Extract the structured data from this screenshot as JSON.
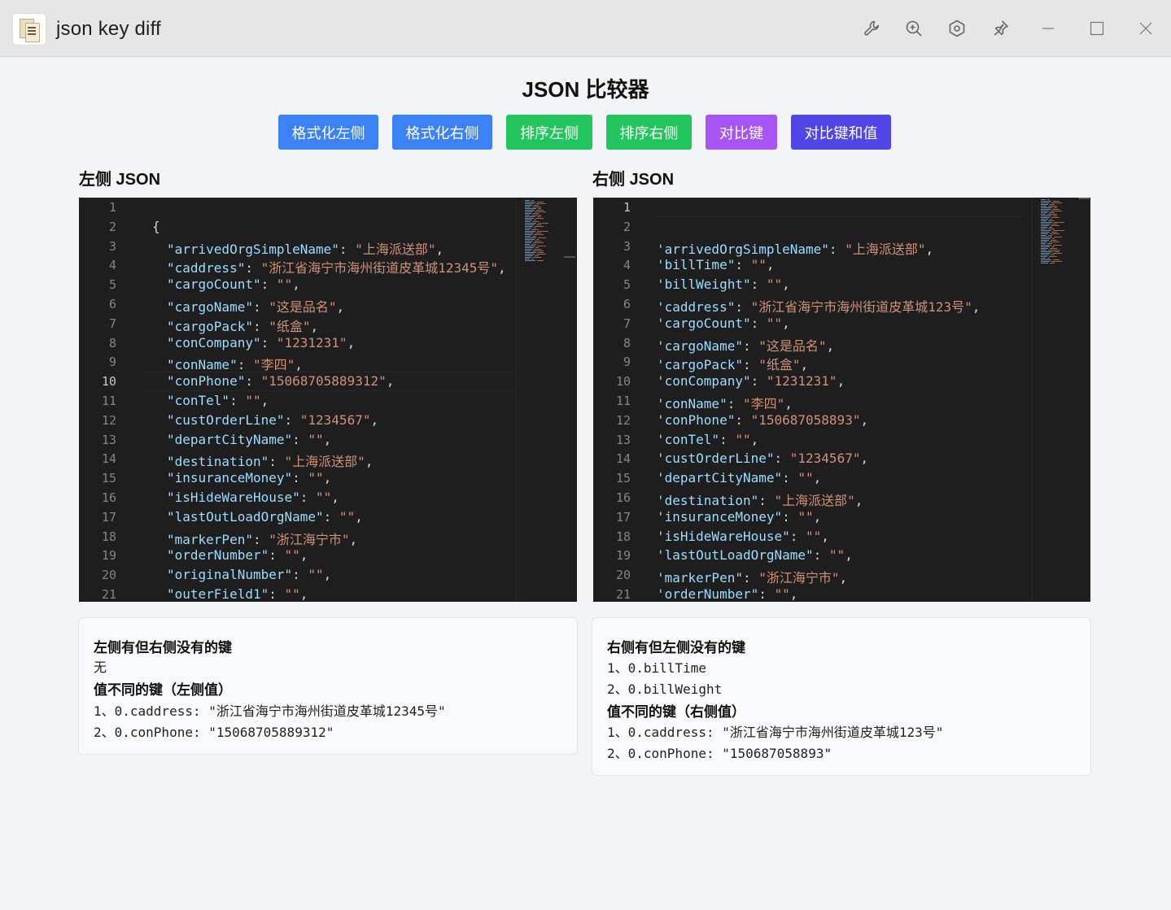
{
  "window": {
    "title": "json key diff",
    "toolbar_icons": [
      "wrench-icon",
      "zoom-in-icon",
      "settings-hex-icon",
      "pin-icon"
    ],
    "controls": [
      "minimize",
      "maximize",
      "close"
    ]
  },
  "page": {
    "title": "JSON 比较器"
  },
  "buttons": [
    {
      "label": "格式化左侧",
      "color": "#3b82f6"
    },
    {
      "label": "格式化右侧",
      "color": "#3b82f6"
    },
    {
      "label": "排序左侧",
      "color": "#22c55e"
    },
    {
      "label": "排序右侧",
      "color": "#22c55e"
    },
    {
      "label": "对比键",
      "color": "#a855f7"
    },
    {
      "label": "对比键和值",
      "color": "#4f46e5"
    }
  ],
  "left": {
    "label": "左侧 JSON",
    "lines": [
      [
        "1",
        ""
      ],
      [
        "2",
        "{"
      ],
      [
        "3",
        "arrivedOrgSimpleName",
        "上海派送部"
      ],
      [
        "4",
        "caddress",
        "浙江省海宁市海州街道皮革城12345号"
      ],
      [
        "5",
        "cargoCount",
        ""
      ],
      [
        "6",
        "cargoName",
        "这是品名"
      ],
      [
        "7",
        "cargoPack",
        "纸盒"
      ],
      [
        "8",
        "conCompany",
        "1231231"
      ],
      [
        "9",
        "conName",
        "李四"
      ],
      [
        "10",
        "conPhone",
        "15068705889312"
      ],
      [
        "11",
        "conTel",
        ""
      ],
      [
        "12",
        "custOrderLine",
        "1234567"
      ],
      [
        "13",
        "departCityName",
        ""
      ],
      [
        "14",
        "destination",
        "上海派送部"
      ],
      [
        "15",
        "insuranceMoney",
        ""
      ],
      [
        "16",
        "isHideWareHouse",
        ""
      ],
      [
        "17",
        "lastOutLoadOrgName",
        ""
      ],
      [
        "18",
        "markerPen",
        "浙江海宁市"
      ],
      [
        "19",
        "orderNumber",
        ""
      ],
      [
        "20",
        "originalNumber",
        ""
      ],
      [
        "21",
        "outerField1",
        ""
      ]
    ],
    "result": {
      "missing_title": "左侧有但右侧没有的键",
      "missing_items": [
        "无"
      ],
      "diff_title": "值不同的键（左侧值）",
      "diff_items": [
        "1、0.caddress: \"浙江省海宁市海州街道皮革城12345号\"",
        "2、0.conPhone: \"15068705889312\""
      ]
    }
  },
  "right": {
    "label": "右侧 JSON",
    "lines": [
      [
        "1",
        ""
      ],
      [
        "2",
        ""
      ],
      [
        "3",
        "arrivedOrgSimpleName",
        "上海派送部"
      ],
      [
        "4",
        "billTime",
        ""
      ],
      [
        "5",
        "billWeight",
        ""
      ],
      [
        "6",
        "caddress",
        "浙江省海宁市海州街道皮革城123号"
      ],
      [
        "7",
        "cargoCount",
        ""
      ],
      [
        "8",
        "cargoName",
        "这是品名"
      ],
      [
        "9",
        "cargoPack",
        "纸盒"
      ],
      [
        "10",
        "conCompany",
        "1231231"
      ],
      [
        "11",
        "conName",
        "李四"
      ],
      [
        "12",
        "conPhone",
        "150687058893"
      ],
      [
        "13",
        "conTel",
        ""
      ],
      [
        "14",
        "custOrderLine",
        "1234567"
      ],
      [
        "15",
        "departCityName",
        ""
      ],
      [
        "16",
        "destination",
        "上海派送部"
      ],
      [
        "17",
        "insuranceMoney",
        ""
      ],
      [
        "18",
        "isHideWareHouse",
        ""
      ],
      [
        "19",
        "lastOutLoadOrgName",
        ""
      ],
      [
        "20",
        "markerPen",
        "浙江海宁市"
      ],
      [
        "21",
        "orderNumber",
        ""
      ]
    ],
    "result": {
      "missing_title": "右侧有但左侧没有的键",
      "missing_items": [
        "1、0.billTime",
        "2、0.billWeight"
      ],
      "diff_title": "值不同的键（右侧值）",
      "diff_items": [
        "1、0.caddress: \"浙江省海宁市海州街道皮革城123号\"",
        "2、0.conPhone: \"150687058893\""
      ]
    }
  }
}
